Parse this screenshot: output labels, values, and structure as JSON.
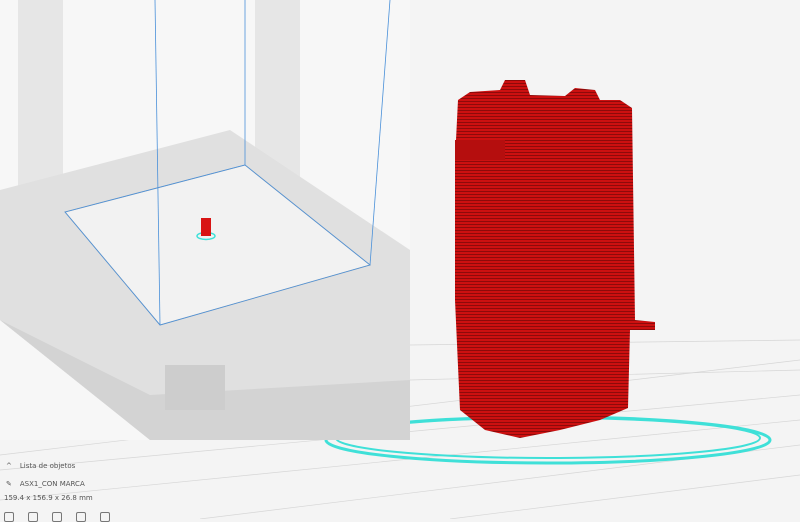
{
  "object_list": {
    "header": "Lista de objetos",
    "object_name": "ASX1_CON MARCA",
    "dimensions": "159.4 x 156.9 x 26.8 mm"
  },
  "colors": {
    "model": "#d81414",
    "skirt": "#3fe0d8",
    "grid": "#cfcfcf",
    "build_volume": "#4a90d9"
  }
}
